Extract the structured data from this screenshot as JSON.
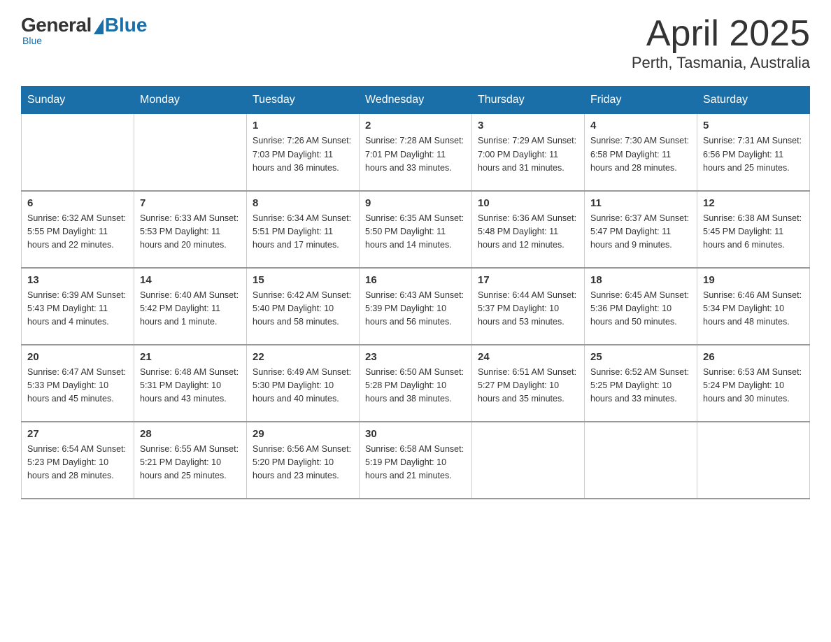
{
  "logo": {
    "general": "General",
    "blue": "Blue",
    "subtitle": "Blue"
  },
  "title": {
    "month_year": "April 2025",
    "location": "Perth, Tasmania, Australia"
  },
  "headers": [
    "Sunday",
    "Monday",
    "Tuesday",
    "Wednesday",
    "Thursday",
    "Friday",
    "Saturday"
  ],
  "weeks": [
    [
      {
        "num": "",
        "info": ""
      },
      {
        "num": "",
        "info": ""
      },
      {
        "num": "1",
        "info": "Sunrise: 7:26 AM\nSunset: 7:03 PM\nDaylight: 11 hours\nand 36 minutes."
      },
      {
        "num": "2",
        "info": "Sunrise: 7:28 AM\nSunset: 7:01 PM\nDaylight: 11 hours\nand 33 minutes."
      },
      {
        "num": "3",
        "info": "Sunrise: 7:29 AM\nSunset: 7:00 PM\nDaylight: 11 hours\nand 31 minutes."
      },
      {
        "num": "4",
        "info": "Sunrise: 7:30 AM\nSunset: 6:58 PM\nDaylight: 11 hours\nand 28 minutes."
      },
      {
        "num": "5",
        "info": "Sunrise: 7:31 AM\nSunset: 6:56 PM\nDaylight: 11 hours\nand 25 minutes."
      }
    ],
    [
      {
        "num": "6",
        "info": "Sunrise: 6:32 AM\nSunset: 5:55 PM\nDaylight: 11 hours\nand 22 minutes."
      },
      {
        "num": "7",
        "info": "Sunrise: 6:33 AM\nSunset: 5:53 PM\nDaylight: 11 hours\nand 20 minutes."
      },
      {
        "num": "8",
        "info": "Sunrise: 6:34 AM\nSunset: 5:51 PM\nDaylight: 11 hours\nand 17 minutes."
      },
      {
        "num": "9",
        "info": "Sunrise: 6:35 AM\nSunset: 5:50 PM\nDaylight: 11 hours\nand 14 minutes."
      },
      {
        "num": "10",
        "info": "Sunrise: 6:36 AM\nSunset: 5:48 PM\nDaylight: 11 hours\nand 12 minutes."
      },
      {
        "num": "11",
        "info": "Sunrise: 6:37 AM\nSunset: 5:47 PM\nDaylight: 11 hours\nand 9 minutes."
      },
      {
        "num": "12",
        "info": "Sunrise: 6:38 AM\nSunset: 5:45 PM\nDaylight: 11 hours\nand 6 minutes."
      }
    ],
    [
      {
        "num": "13",
        "info": "Sunrise: 6:39 AM\nSunset: 5:43 PM\nDaylight: 11 hours\nand 4 minutes."
      },
      {
        "num": "14",
        "info": "Sunrise: 6:40 AM\nSunset: 5:42 PM\nDaylight: 11 hours\nand 1 minute."
      },
      {
        "num": "15",
        "info": "Sunrise: 6:42 AM\nSunset: 5:40 PM\nDaylight: 10 hours\nand 58 minutes."
      },
      {
        "num": "16",
        "info": "Sunrise: 6:43 AM\nSunset: 5:39 PM\nDaylight: 10 hours\nand 56 minutes."
      },
      {
        "num": "17",
        "info": "Sunrise: 6:44 AM\nSunset: 5:37 PM\nDaylight: 10 hours\nand 53 minutes."
      },
      {
        "num": "18",
        "info": "Sunrise: 6:45 AM\nSunset: 5:36 PM\nDaylight: 10 hours\nand 50 minutes."
      },
      {
        "num": "19",
        "info": "Sunrise: 6:46 AM\nSunset: 5:34 PM\nDaylight: 10 hours\nand 48 minutes."
      }
    ],
    [
      {
        "num": "20",
        "info": "Sunrise: 6:47 AM\nSunset: 5:33 PM\nDaylight: 10 hours\nand 45 minutes."
      },
      {
        "num": "21",
        "info": "Sunrise: 6:48 AM\nSunset: 5:31 PM\nDaylight: 10 hours\nand 43 minutes."
      },
      {
        "num": "22",
        "info": "Sunrise: 6:49 AM\nSunset: 5:30 PM\nDaylight: 10 hours\nand 40 minutes."
      },
      {
        "num": "23",
        "info": "Sunrise: 6:50 AM\nSunset: 5:28 PM\nDaylight: 10 hours\nand 38 minutes."
      },
      {
        "num": "24",
        "info": "Sunrise: 6:51 AM\nSunset: 5:27 PM\nDaylight: 10 hours\nand 35 minutes."
      },
      {
        "num": "25",
        "info": "Sunrise: 6:52 AM\nSunset: 5:25 PM\nDaylight: 10 hours\nand 33 minutes."
      },
      {
        "num": "26",
        "info": "Sunrise: 6:53 AM\nSunset: 5:24 PM\nDaylight: 10 hours\nand 30 minutes."
      }
    ],
    [
      {
        "num": "27",
        "info": "Sunrise: 6:54 AM\nSunset: 5:23 PM\nDaylight: 10 hours\nand 28 minutes."
      },
      {
        "num": "28",
        "info": "Sunrise: 6:55 AM\nSunset: 5:21 PM\nDaylight: 10 hours\nand 25 minutes."
      },
      {
        "num": "29",
        "info": "Sunrise: 6:56 AM\nSunset: 5:20 PM\nDaylight: 10 hours\nand 23 minutes."
      },
      {
        "num": "30",
        "info": "Sunrise: 6:58 AM\nSunset: 5:19 PM\nDaylight: 10 hours\nand 21 minutes."
      },
      {
        "num": "",
        "info": ""
      },
      {
        "num": "",
        "info": ""
      },
      {
        "num": "",
        "info": ""
      }
    ]
  ]
}
